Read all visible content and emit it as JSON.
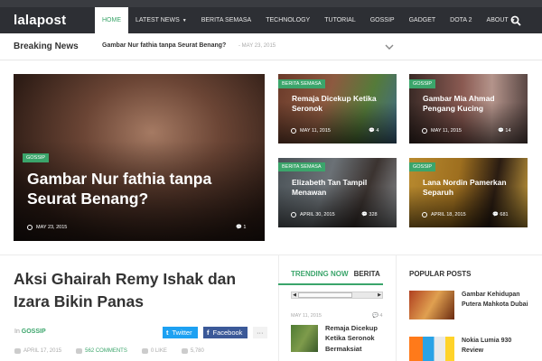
{
  "site": {
    "logo": "lalapost"
  },
  "nav": {
    "items": [
      {
        "label": "HOME",
        "active": true
      },
      {
        "label": "LATEST NEWS",
        "dropdown": true
      },
      {
        "label": "BERITA SEMASA"
      },
      {
        "label": "TECHNOLOGY"
      },
      {
        "label": "TUTORIAL"
      },
      {
        "label": "GOSSIP"
      },
      {
        "label": "GADGET"
      },
      {
        "label": "DOTA 2"
      },
      {
        "label": "ABOUT",
        "dropdown": true
      }
    ],
    "search_icon": "search-icon"
  },
  "breaking": {
    "title": "Breaking News",
    "headline": "Gambar Nur fathia tanpa Seurat Benang?",
    "date": "- MAY 23, 2015"
  },
  "featured": {
    "main": {
      "category": "GOSSIP",
      "title": "Gambar Nur fathia tanpa Seurat Benang?",
      "date": "MAY 23, 2015",
      "comments": "1"
    },
    "tiles": [
      {
        "category": "BERITA SEMASA",
        "title": "Remaja Dicekup Ketika Seronok",
        "date": "MAY 11, 2015",
        "count": "4"
      },
      {
        "category": "GOSSIP",
        "title": "Gambar Mia Ahmad Pengang Kucing",
        "date": "MAY 11, 2015",
        "count": "14"
      },
      {
        "category": "BERITA SEMASA",
        "title": "Elizabeth Tan Tampil Menawan",
        "date": "APRIL 30, 2015",
        "count": "328"
      },
      {
        "category": "GOSSIP",
        "title": "Lana Nordin Pamerkan Separuh",
        "date": "APRIL 18, 2015",
        "count": "681"
      }
    ]
  },
  "article": {
    "title": "Aksi Ghairah Remy Ishak dan Izara Bikin Panas",
    "in_label": "In",
    "category": "GOSSIP",
    "share": {
      "twitter": "Twitter",
      "facebook": "Facebook",
      "more": "···"
    },
    "meta": {
      "date": "APRIL 17, 2015",
      "comments": "562 COMMENTS",
      "likes": "0 LIKE",
      "views": "5,780"
    }
  },
  "trending": {
    "tab_active": "TRENDING NOW",
    "tab_other": "BERITA",
    "item": {
      "date": "MAY 11, 2015",
      "count": "4",
      "title": "Remaja Dicekup Ketika Seronok Bermaksiat"
    }
  },
  "popular": {
    "title": "POPULAR POSTS",
    "items": [
      {
        "title": "Gambar Kehidupan Putera Mahkota Dubai"
      },
      {
        "title": "Nokia Lumia 930 Review"
      }
    ]
  },
  "colors": {
    "accent": "#3ba56b",
    "topbar": "#2d2f34",
    "twitter": "#1da1f2",
    "facebook": "#3b5998"
  }
}
